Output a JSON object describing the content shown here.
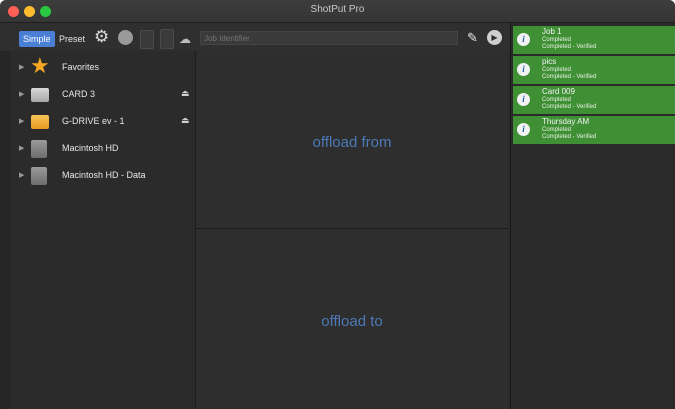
{
  "window": {
    "title": "ShotPut Pro"
  },
  "toolbar": {
    "simple_label": "Simple",
    "preset_label": "Preset",
    "job_placeholder": "Job Identifier"
  },
  "sidebar": {
    "items": [
      {
        "label": "Favorites",
        "icon": "star-icon"
      },
      {
        "label": "CARD 3",
        "icon": "drive-icon",
        "ejectable": true
      },
      {
        "label": "G-DRIVE ev - 1",
        "icon": "drive-icon",
        "ejectable": true
      },
      {
        "label": "Macintosh HD",
        "icon": "hard-disk-icon"
      },
      {
        "label": "Macintosh HD - Data",
        "icon": "hard-disk-icon"
      }
    ]
  },
  "zones": {
    "from_label": "offload from",
    "to_label": "offload to"
  },
  "jobs": [
    {
      "name": "Job 1",
      "status1": "Completed",
      "status2": "Completed - Verified"
    },
    {
      "name": "pics",
      "status1": "Completed",
      "status2": "Completed - Verified"
    },
    {
      "name": "Card 009",
      "status1": "Completed",
      "status2": "Completed - Verified"
    },
    {
      "name": "Thursday AM",
      "status1": "Completed",
      "status2": "Completed - Verified"
    }
  ],
  "colors": {
    "accent": "#4a7fd6",
    "job_green": "#3f8f34",
    "zone_text": "#4c79b7"
  }
}
